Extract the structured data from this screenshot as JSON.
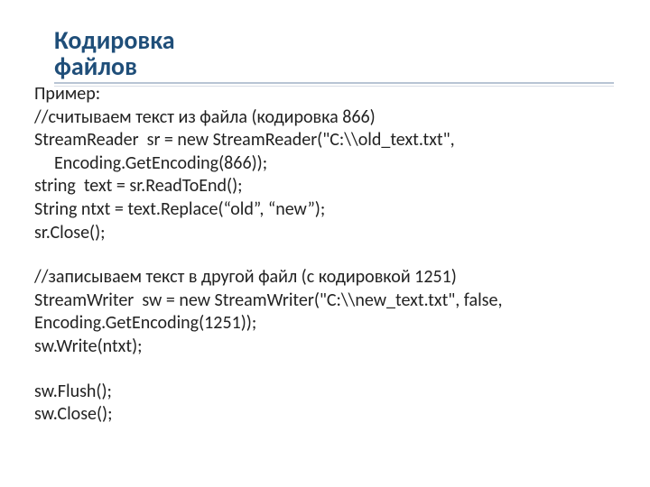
{
  "title_line1": "Кодировка",
  "title_line2": "файлов",
  "lines": {
    "l0": "Пример:",
    "l1": "//считываем текст из файла (кодировка 866)",
    "l2": "StreamReader  sr = new StreamReader(\"C:\\\\old_text.txt\",",
    "l3": "Encoding.GetEncoding(866));",
    "l4": "string  text = sr.ReadToEnd();",
    "l5": "String ntxt = text.Replace(“old”, “new”);",
    "l6": "sr.Close();",
    "l7": "//записываем текст в другой файл (с кодировкой 1251)",
    "l8": "StreamWriter  sw = new StreamWriter(\"C:\\\\new_text.txt\", false,",
    "l9": "Encoding.GetEncoding(1251));",
    "l10": "sw.Write(ntxt);",
    "l11": "sw.Flush();",
    "l12": "sw.Close();"
  }
}
